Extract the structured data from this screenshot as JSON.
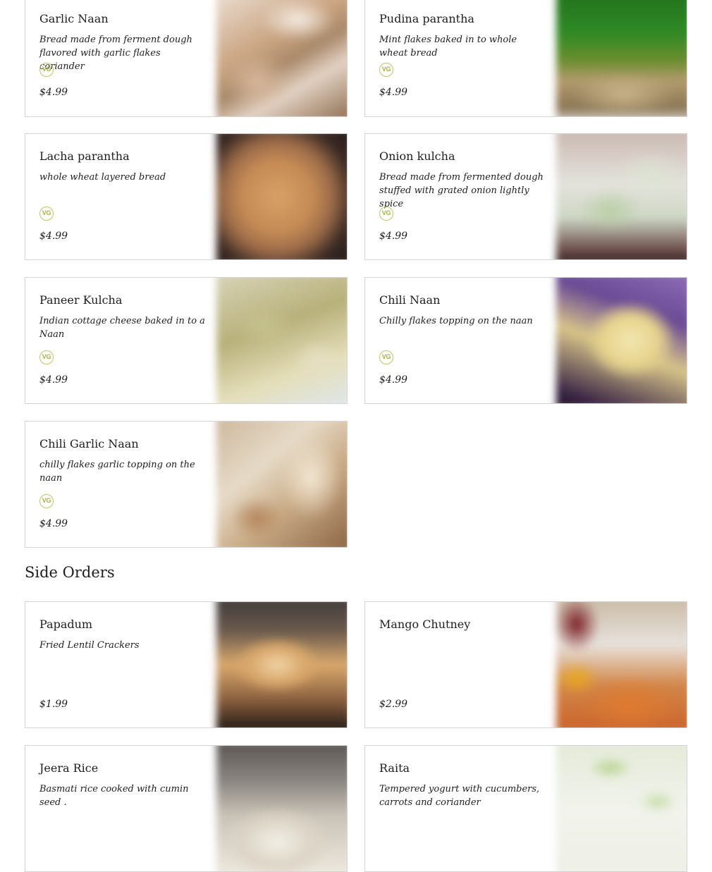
{
  "vg_badge": "VG",
  "section": {
    "side_orders_heading": "Side Orders"
  },
  "breads": [
    {
      "name": "Garlic Naan",
      "description": "Bread made from ferment dough flavored with garlic flakes coriander",
      "vegetarian": true,
      "price": "$4.99"
    },
    {
      "name": "Pudina parantha",
      "description": "Mint flakes baked in to whole wheat bread",
      "vegetarian": true,
      "price": "$4.99"
    },
    {
      "name": "Lacha parantha",
      "description": "whole wheat layered bread",
      "vegetarian": true,
      "price": "$4.99"
    },
    {
      "name": "Onion kulcha",
      "description": "Bread made from fermented dough stuffed with grated onion lightly spice",
      "vegetarian": true,
      "price": "$4.99"
    },
    {
      "name": "Paneer Kulcha",
      "description": "Indian cottage cheese baked in to a Naan",
      "vegetarian": true,
      "price": "$4.99"
    },
    {
      "name": "Chili Naan",
      "description": "Chilly flakes topping on the naan",
      "vegetarian": true,
      "price": "$4.99"
    },
    {
      "name": "Chili Garlic Naan",
      "description": "chilly flakes garlic topping on the naan",
      "vegetarian": true,
      "price": "$4.99"
    }
  ],
  "side_orders": [
    {
      "name": "Papadum",
      "description": "Fried Lentil Crackers",
      "price": "$1.99"
    },
    {
      "name": "Mango Chutney",
      "description": "",
      "price": "$2.99"
    },
    {
      "name": "Jeera Rice",
      "description": "Basmati rice cooked with cumin seed .",
      "price": ""
    },
    {
      "name": "Raita",
      "description": "Tempered yogurt with cucumbers, carrots and coriander",
      "price": ""
    }
  ]
}
